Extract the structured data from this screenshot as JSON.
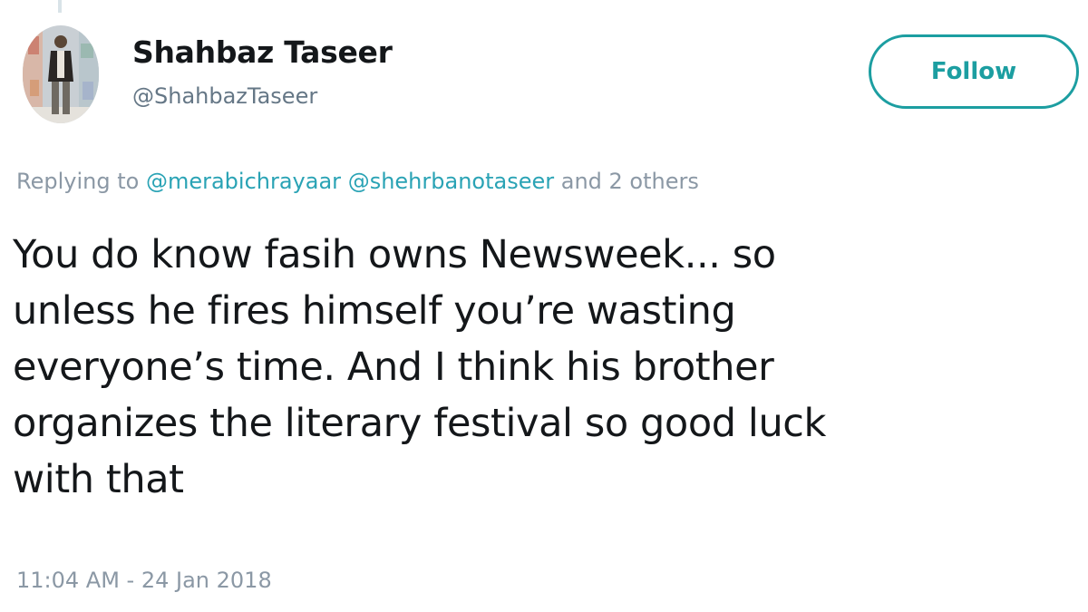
{
  "author": {
    "display_name": "Shahbaz Taseer",
    "handle": "@ShahbazTaseer"
  },
  "follow_button": {
    "label": "Follow"
  },
  "reply_context": {
    "prefix": "Replying to",
    "mentions": [
      "@merabichrayaar",
      "@shehrbanotaseer"
    ],
    "suffix": "and 2 others"
  },
  "tweet": {
    "lines": [
      "You do know fasih owns Newsweek... so",
      "unless he fires himself you’re wasting",
      "everyone’s time. And I think his brother",
      "organizes the literary festival so good luck",
      "with that"
    ],
    "timestamp": "11:04 AM - 24 Jan 2018"
  },
  "colors": {
    "accent": "#1c9ea1",
    "mention": "#2aa3b5",
    "secondary_text": "#8b98a5",
    "primary_text": "#14171a"
  },
  "icons": {
    "avatar": "profile-photo"
  }
}
